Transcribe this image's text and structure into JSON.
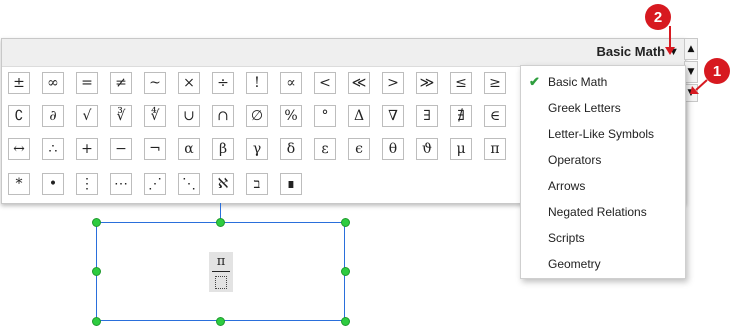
{
  "panel": {
    "title": "Basic Math",
    "caret": "▼",
    "scroll_up": "▲",
    "scroll_down": "▼",
    "expand": "▼"
  },
  "symbols": {
    "row1": [
      "±",
      "∞",
      "=",
      "≠",
      "~",
      "×",
      "÷",
      "!",
      "∝",
      "<",
      "≪",
      ">",
      "≫",
      "≤",
      "≥"
    ],
    "row2": [
      "∁",
      "∂",
      "√",
      "∛",
      "∜",
      "∪",
      "∩",
      "∅",
      "%",
      "°",
      "Δ",
      "∇",
      "∃",
      "∄",
      "∈"
    ],
    "row3": [
      "↔",
      "∴",
      "+",
      "−",
      "¬",
      "α",
      "β",
      "γ",
      "δ",
      "ε",
      "ϵ",
      "θ",
      "ϑ",
      "μ",
      "π"
    ],
    "row4": [
      "*",
      "•",
      "⋮",
      "⋯",
      "⋰",
      "⋱",
      "ℵ",
      "ב",
      "∎"
    ]
  },
  "dropdown": {
    "check": "✔",
    "items": [
      "Basic Math",
      "Greek Letters",
      "Letter-Like Symbols",
      "Operators",
      "Arrows",
      "Negated Relations",
      "Scripts",
      "Geometry"
    ],
    "selected": "Basic Math"
  },
  "callouts": {
    "one": "1",
    "two": "2"
  },
  "equation": {
    "numerator": "π"
  },
  "colors": {
    "callout": "#d71920",
    "check": "#2e9e3e",
    "selection": "#2a6fdb",
    "handle": "#2ecc40"
  }
}
